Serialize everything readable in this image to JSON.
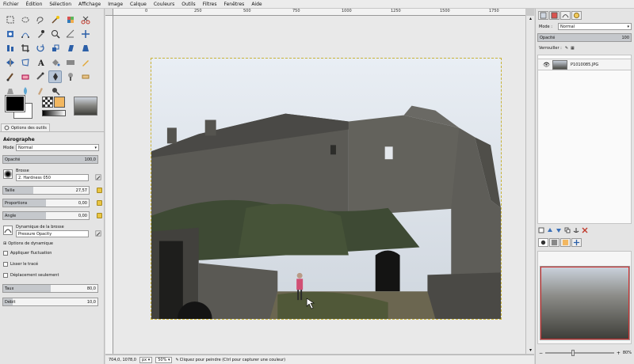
{
  "menubar": {
    "items": [
      "Fichier",
      "Édition",
      "Sélection",
      "Affichage",
      "Image",
      "Calque",
      "Couleurs",
      "Outils",
      "Filtres",
      "Fenêtres",
      "Aide"
    ]
  },
  "toolbox": {
    "tools": [
      "rect-select-icon",
      "ellipse-select-icon",
      "lasso-icon",
      "fuzzy-select-icon",
      "color-select-icon",
      "scissors-icon",
      "foreground-select-icon",
      "paths-icon",
      "color-picker-icon",
      "zoom-icon",
      "measure-icon",
      "move-icon",
      "align-icon",
      "crop-icon",
      "rotate-icon",
      "scale-icon",
      "shear-icon",
      "perspective-icon",
      "flip-icon",
      "cage-icon",
      "text-icon",
      "bucket-fill-icon",
      "blend-icon",
      "pencil-icon",
      "paintbrush-icon",
      "eraser-icon",
      "airbrush-icon",
      "ink-icon",
      "clone-icon",
      "heal-icon",
      "perspective-clone-icon",
      "blur-icon",
      "smudge-icon",
      "dodge-burn-icon"
    ],
    "active_tool_index": 27
  },
  "tool_options": {
    "tab_label": "Options des outils",
    "title": "Aérographe",
    "mode_label": "Mode :",
    "mode_value": "Normal",
    "opacity_label": "Opacité",
    "opacity_value": "100,0",
    "opacity_fraction": 1.0,
    "brush_label": "Brosse",
    "brush_value": "2. Hardness 050",
    "size_label": "Taille",
    "size_value": "27,57",
    "size_fraction": 0.35,
    "ratio_label": "Proportions",
    "ratio_value": "0,00",
    "ratio_fraction": 0.5,
    "angle_label": "Angle",
    "angle_value": "0,00",
    "angle_fraction": 0.5,
    "dynamics_label": "Dynamique de la brosse",
    "dynamics_value": "Pressure Opacity",
    "dynamics_options_label": "Options de dynamique",
    "fluctuation_label": "Appliquer fluctuation",
    "smooth_label": "Lisser le tracé",
    "incremental_label": "Déplacement seulement",
    "rate_label": "Taux",
    "rate_value": "80,0",
    "rate_fraction": 0.5,
    "flow_label": "Débit",
    "flow_value": "10,0",
    "flow_fraction": 0.1
  },
  "rulers": {
    "top_labels": [
      "0",
      "250",
      "500",
      "750",
      "1000",
      "1250",
      "1500",
      "1750"
    ]
  },
  "status": {
    "coords": "704,0, 1078,0",
    "unit": "px",
    "zoom": "50%",
    "message": "Cliquez pour peindre (Ctrl pour capturer une couleur)"
  },
  "dock": {
    "mode_label": "Mode :",
    "mode_value": "Normal",
    "opacity_label": "Opacité",
    "opacity_value": "100",
    "lock_label": "Verrouiller :",
    "layer_name": "P1010085.JPG",
    "zoom_value": "80%"
  }
}
